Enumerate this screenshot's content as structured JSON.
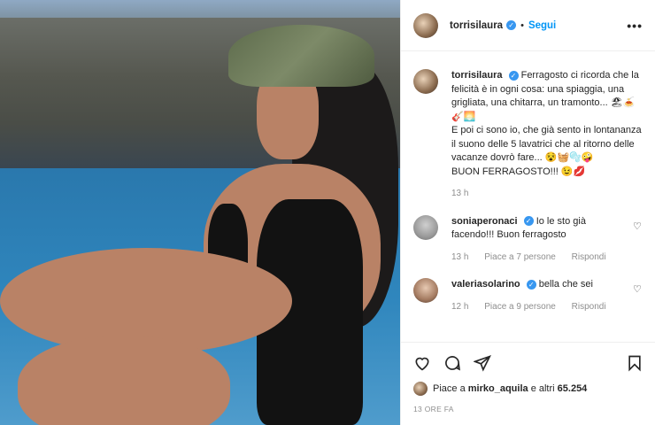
{
  "header": {
    "username": "torrisilaura",
    "separator": "•",
    "follow_label": "Segui",
    "more_label": "•••"
  },
  "caption": {
    "username": "torrisilaura",
    "text_1": "Ferragosto ci ricorda che la felicità è in ogni cosa: una spiaggia, una grigliata, una chitarra, un tramonto... 🏖🍝🎸🌅",
    "text_2": "E poi ci sono io, che già sento in lontananza il suono delle 5 lavatrici che al ritorno delle vacanze dovrò fare... 😵🧺🫧🤪",
    "text_3": "BUON FERRAGOSTO!!! 😉💋",
    "time": "13 h"
  },
  "comments": [
    {
      "username": "soniaperonaci",
      "text": "Io le sto già facendo!!! Buon ferragosto",
      "time": "13 h",
      "likes": "Piace a 7 persone",
      "reply": "Rispondi"
    },
    {
      "username": "valeriasolarino",
      "text": "bella che sei",
      "time": "12 h",
      "likes": "Piace a 9 persone",
      "reply": "Rispondi"
    }
  ],
  "likes": {
    "prefix": "Piace a",
    "user": "mirko_aquila",
    "middle": "e altri",
    "count": "65.254"
  },
  "timestamp": "13 ORE FA",
  "icons": [
    "verified-badge-icon",
    "more-icon",
    "heart-icon",
    "comment-icon",
    "share-icon",
    "bookmark-icon"
  ],
  "colors": {
    "accent": "#0095f6",
    "verified": "#3897f0",
    "muted": "#8e8e8e"
  }
}
